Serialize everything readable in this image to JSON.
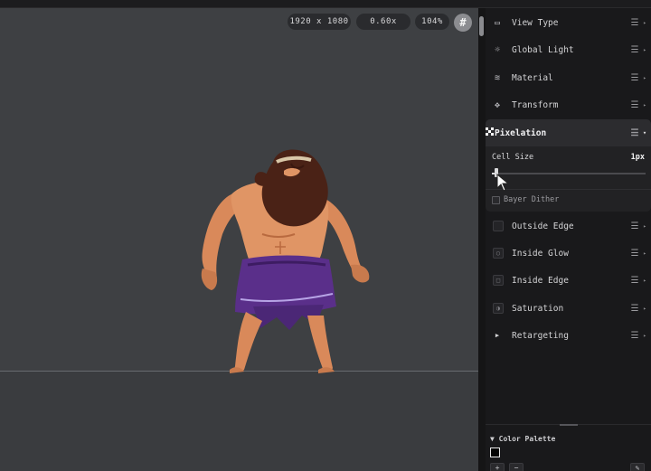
{
  "viewport": {
    "resolution": "1920 x 1080",
    "scale": "0.60x",
    "zoom": "104%",
    "grid_icon": "#"
  },
  "panel": {
    "effects": [
      {
        "label": "View Type",
        "icon": "monitor-icon",
        "glyph": "▭"
      },
      {
        "label": "Global Light",
        "icon": "sun-icon",
        "glyph": "☼"
      },
      {
        "label": "Material",
        "icon": "layers-icon",
        "glyph": "≋"
      },
      {
        "label": "Transform",
        "icon": "move-icon",
        "glyph": "✥"
      }
    ],
    "pixelation": {
      "label": "Pixelation",
      "icon": "checker-icon",
      "cell_size_label": "Cell Size",
      "cell_size_value": "1px",
      "cell_size_fraction": 0.02,
      "dither_label": "Bayer Dither",
      "dither_checked": false
    },
    "effects2": [
      {
        "label": "Outside Edge",
        "icon": "outside-edge-icon",
        "glyph": ""
      },
      {
        "label": "Inside Glow",
        "icon": "glow-icon",
        "glyph": "○"
      },
      {
        "label": "Inside Edge",
        "icon": "inside-edge-icon",
        "glyph": "□"
      },
      {
        "label": "Saturation",
        "icon": "contrast-icon",
        "glyph": "◑"
      }
    ],
    "retargeting": {
      "label": "Retargeting",
      "glyph": "▶"
    },
    "menu_glyph": "☰",
    "caret_glyph": "▸",
    "caret_open_glyph": "▾"
  },
  "palette": {
    "title": "Color Palette",
    "toggle_glyph": "▼",
    "swatch_color": "#050505",
    "add_label": "+",
    "remove_label": "−",
    "edit_glyph": "✎"
  },
  "colors": {
    "viewport_bg": "#3e4043",
    "panel_bg": "#19191b",
    "accent": "#f0f0f2"
  }
}
